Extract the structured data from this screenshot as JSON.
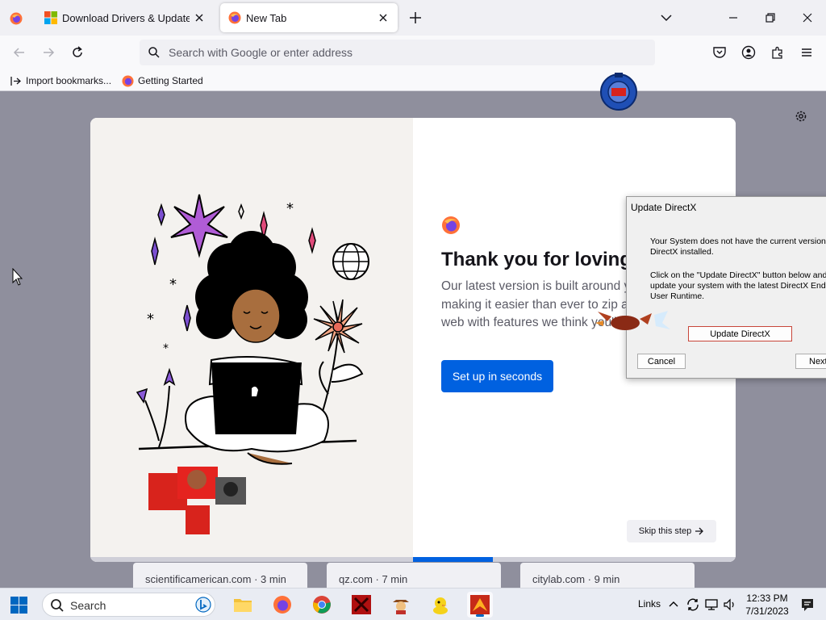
{
  "browser": {
    "tabs": [
      {
        "label": "Download Drivers & Updates fo",
        "favicon": "microsoft-logo-icon"
      },
      {
        "label": "New Tab",
        "favicon": "firefox-icon"
      }
    ],
    "address_bar": {
      "placeholder": "Search with Google or enter address",
      "value": ""
    },
    "bookmarks": [
      {
        "label": "Import bookmarks...",
        "icon": "import-icon"
      },
      {
        "label": "Getting Started",
        "icon": "firefox-icon"
      }
    ]
  },
  "onboarding": {
    "headline": "Thank you for loving F",
    "body": "Our latest version is built around you, making it easier than ever to zip around the web with features we think you'll adore.",
    "primary_button": "Set up in seconds",
    "skip_button": "Skip this step",
    "progress": 0.5
  },
  "top_sites": [
    "scientificamerican.com · 3 min",
    "qz.com · 7 min",
    "citylab.com · 9 min"
  ],
  "dialog": {
    "title": "Update DirectX",
    "message_1": "Your System does not have the current version of DirectX installed.",
    "message_2": "Click on the \"Update DirectX\" button below and update your system with the latest DirectX End-User Runtime.",
    "update_button": "Update DirectX",
    "cancel_button": "Cancel",
    "next_button": "Next"
  },
  "taskbar": {
    "search_placeholder": "Search",
    "links_label": "Links",
    "time": "12:33 PM",
    "date": "7/31/2023"
  },
  "colors": {
    "accent": "#0061e0",
    "brand_orange": "#ff7139",
    "windows_blue": "#0067c0"
  }
}
